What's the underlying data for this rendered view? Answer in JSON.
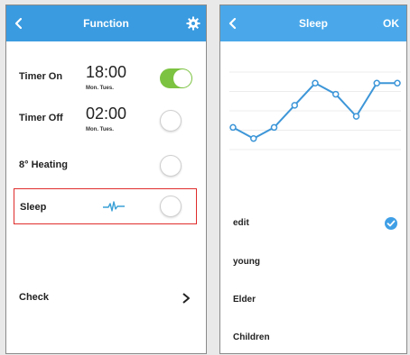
{
  "function_screen": {
    "title": "Function",
    "rows": [
      {
        "label": "Timer On",
        "time": "18:00",
        "days": "Mon. Tues.",
        "enabled": true
      },
      {
        "label": "Timer Off",
        "time": "02:00",
        "days": "Mon. Tues.",
        "enabled": false
      },
      {
        "label": "8° Heating",
        "enabled": false
      },
      {
        "label": "Sleep",
        "enabled": false,
        "highlighted": true
      },
      {
        "label": "Check"
      }
    ]
  },
  "sleep_screen": {
    "title": "Sleep",
    "ok_label": "OK",
    "curve_values": [
      2,
      1,
      2,
      4,
      6,
      5,
      3,
      6,
      6
    ],
    "options": [
      {
        "label": "edit",
        "selected": true
      },
      {
        "label": "young",
        "selected": false
      },
      {
        "label": "Elder",
        "selected": false
      },
      {
        "label": "Children",
        "selected": false
      }
    ]
  },
  "colors": {
    "header_blue": "#3a9be0",
    "toggle_green": "#7cc341",
    "highlight_red": "#e02b2b",
    "check_blue": "#3f9fe6",
    "curve_blue": "#3d96d8"
  }
}
